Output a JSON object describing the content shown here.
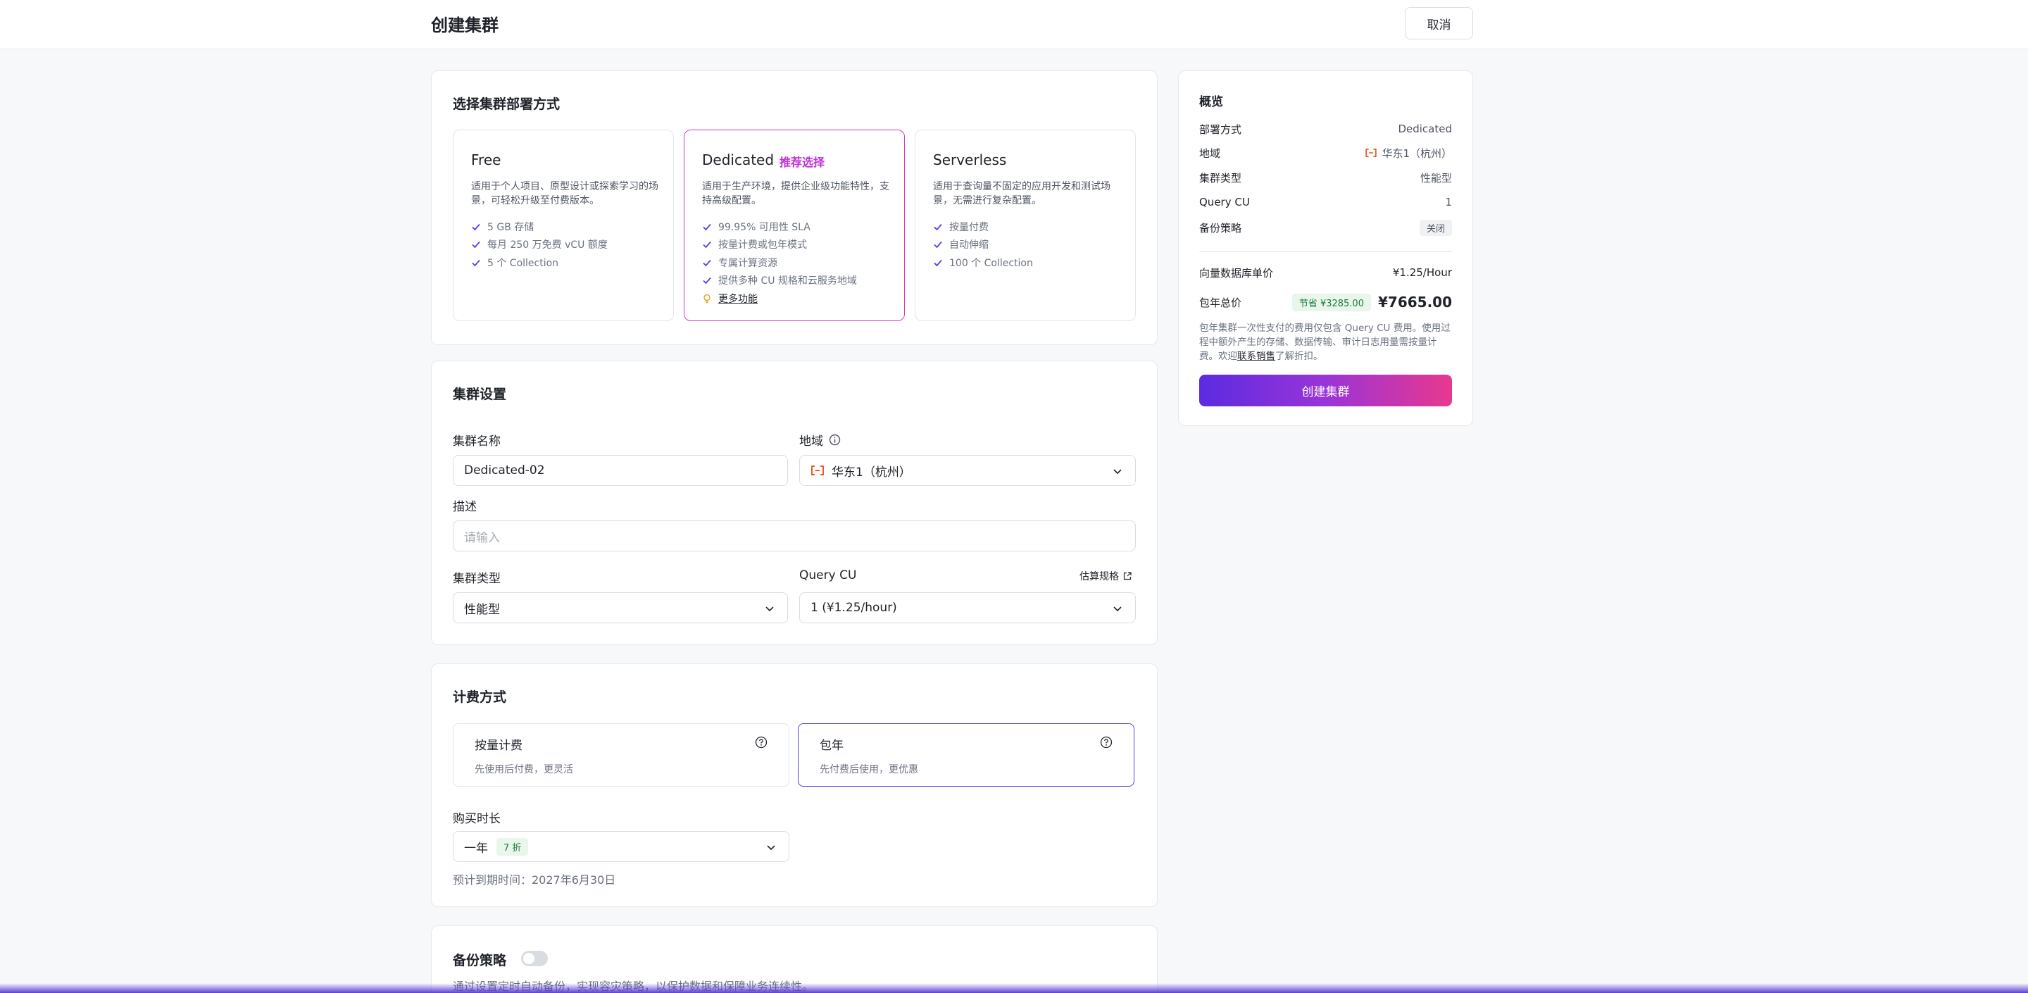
{
  "header": {
    "title": "创建集群",
    "cancel_label": "取消"
  },
  "deployment": {
    "section_title": "选择集群部署方式",
    "options": [
      {
        "name": "Free",
        "badge": "",
        "description": "适用于个人项目、原型设计或探索学习的场景，可轻松升级至付费版本。",
        "features": [
          "5 GB 存储",
          "每月 250 万免费 vCU 额度",
          "5 个 Collection"
        ],
        "more": ""
      },
      {
        "name": "Dedicated",
        "badge": "推荐选择",
        "description": "适用于生产环境，提供企业级功能特性，支持高级配置。",
        "features": [
          "99.95% 可用性 SLA",
          "按量计费或包年模式",
          "专属计算资源",
          "提供多种 CU 规格和云服务地域"
        ],
        "more": "更多功能"
      },
      {
        "name": "Serverless",
        "badge": "",
        "description": "适用于查询量不固定的应用开发和测试场景，无需进行复杂配置。",
        "features": [
          "按量付费",
          "自动伸缩",
          "100 个 Collection"
        ],
        "more": ""
      }
    ],
    "selected": "Dedicated"
  },
  "settings": {
    "section_title": "集群设置",
    "name_label": "集群名称",
    "name_value": "Dedicated-02",
    "region_label": "地域",
    "region_value": "华东1（杭州）",
    "desc_label": "描述",
    "desc_placeholder": "请输入",
    "type_label": "集群类型",
    "type_value": "性能型",
    "cu_label": "Query CU",
    "cu_link": "估算规格",
    "cu_value": "1 (¥1.25/hour)"
  },
  "billing": {
    "section_title": "计费方式",
    "options": [
      {
        "title": "按量计费",
        "desc": "先使用后付费，更灵活"
      },
      {
        "title": "包年",
        "desc": "先付费后使用，更优惠"
      }
    ],
    "selected": "包年",
    "duration_label": "购买时长",
    "duration_value": "一年",
    "duration_discount": "7 折",
    "expiry_text": "预计到期时间：2027年6月30日"
  },
  "backup": {
    "section_title": "备份策略",
    "enabled": false,
    "description": "通过设置定时自动备份，实现容灾策略，以保护数据和保障业务连续性。"
  },
  "summary": {
    "title": "概览",
    "rows": [
      {
        "key": "部署方式",
        "value": "Dedicated"
      },
      {
        "key": "地域",
        "value": "华东1（杭州）"
      },
      {
        "key": "集群类型",
        "value": "性能型"
      },
      {
        "key": "Query CU",
        "value": "1"
      },
      {
        "key": "备份策略",
        "value": "关闭"
      }
    ],
    "unit_price_label": "向量数据库单价",
    "unit_price_value": "¥1.25/Hour",
    "total_label": "包年总价",
    "savings": "节省 ¥3285.00",
    "total_value": "¥7665.00",
    "note_before_link": "包年集群一次性支付的费用仅包含 Query CU 费用。使用过程中额外产生的存储、数据传输、审计日志用量需按量计费。欢迎",
    "note_link": "联系销售",
    "note_after_link": "了解折扣。",
    "create_label": "创建集群"
  },
  "colors": {
    "accent": "#4f46e5",
    "brand_pink": "#d63ac0",
    "check": "#4f46e5",
    "region_icon": "#f05a22"
  }
}
